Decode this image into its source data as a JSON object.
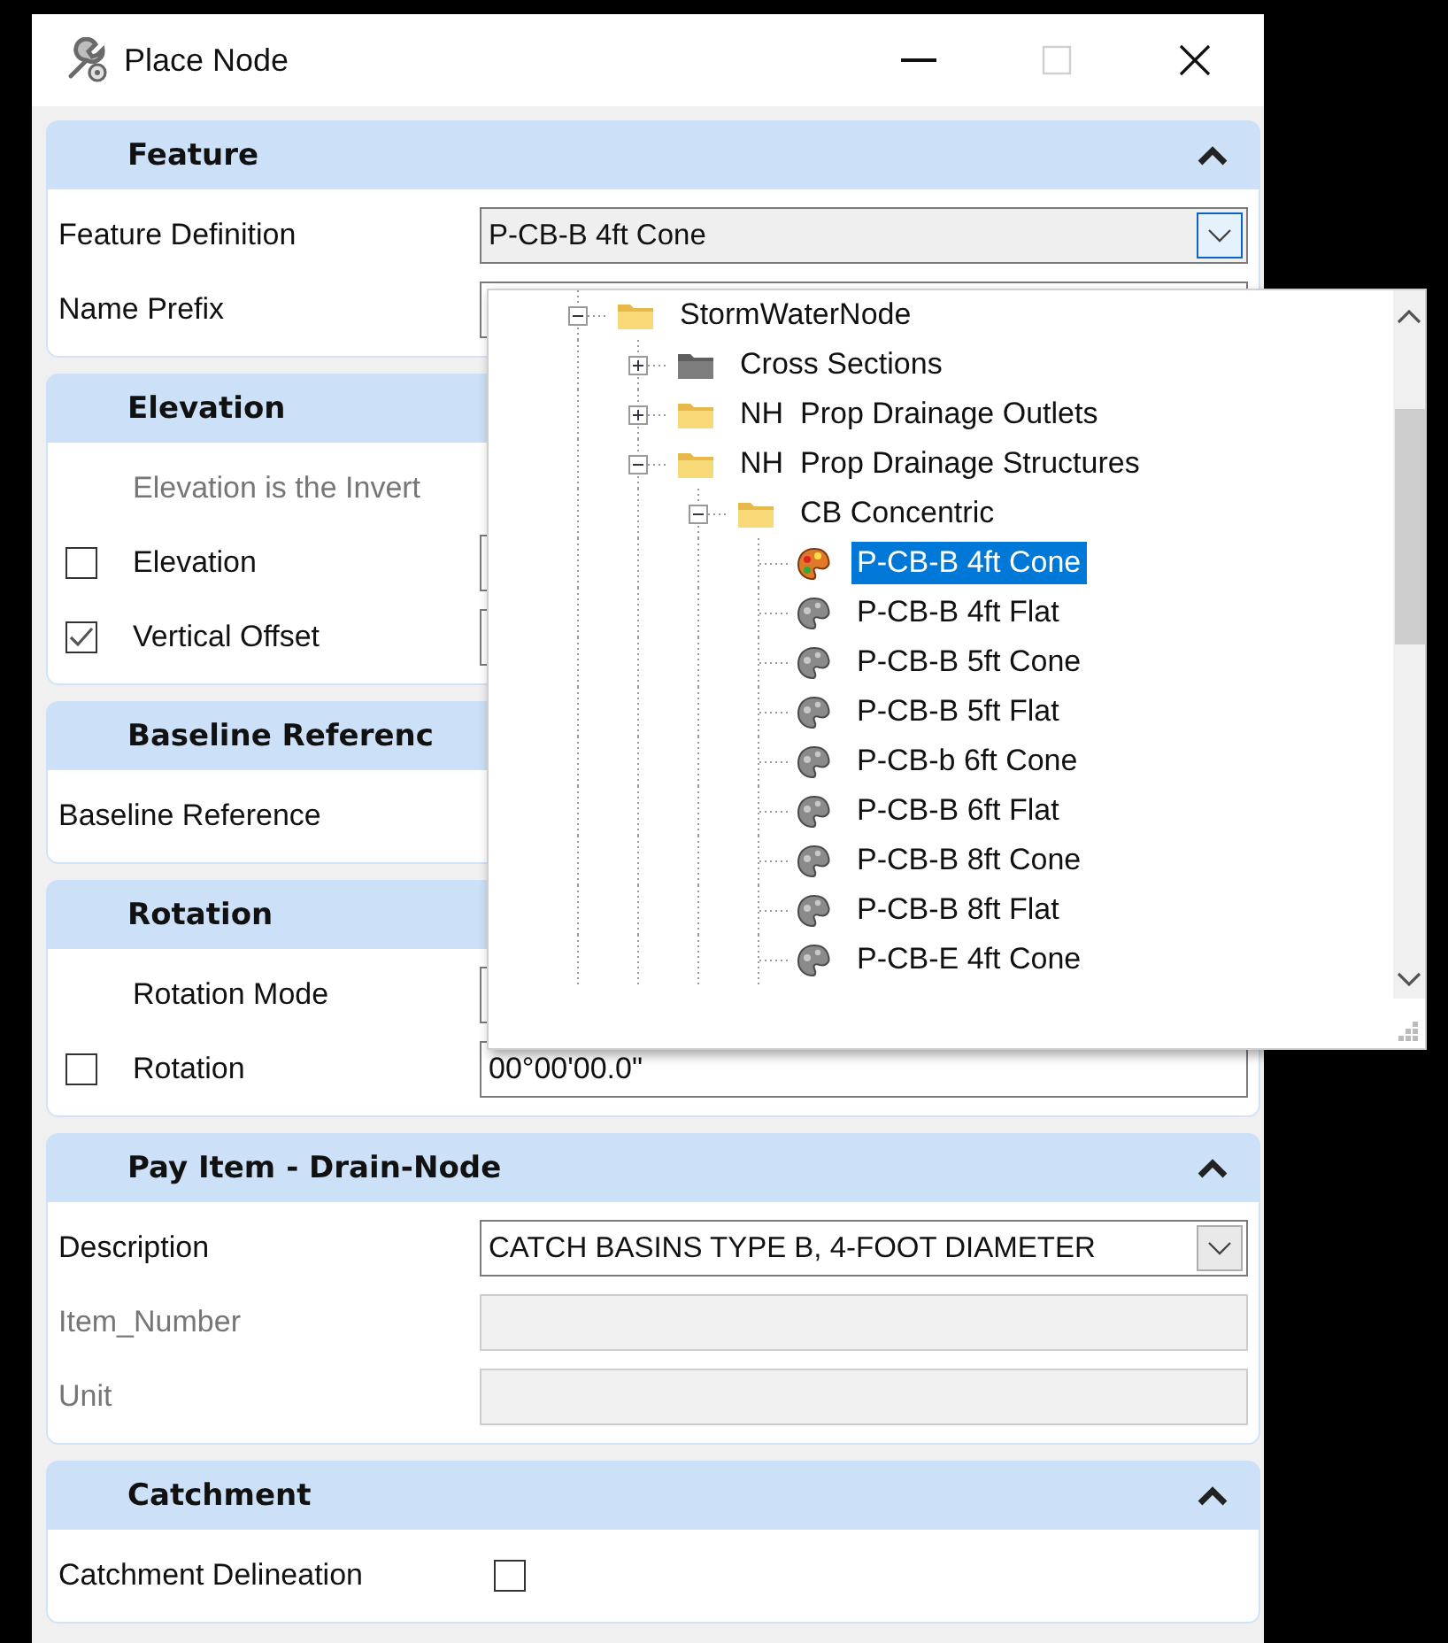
{
  "window": {
    "title": "Place Node"
  },
  "title_buttons": [
    {
      "kind": "minimize",
      "disabled": false
    },
    {
      "kind": "maximize",
      "disabled": true
    },
    {
      "kind": "close",
      "disabled": false
    }
  ],
  "sections": [
    {
      "title": "Feature",
      "expanded": true,
      "rows": [
        {
          "kind": "combo",
          "label": "Feature Definition",
          "value": "P-CB-B 4ft Cone",
          "focused": true
        },
        {
          "kind": "field",
          "label": "Name Prefix",
          "disabled": false
        }
      ]
    },
    {
      "title": "Elevation",
      "rows": [
        {
          "kind": "note",
          "text": "Elevation is the Invert"
        },
        {
          "kind": "check",
          "label": "Elevation",
          "checked": false
        },
        {
          "kind": "check",
          "label": "Vertical Offset",
          "checked": true
        }
      ]
    },
    {
      "title": "Baseline Referenc",
      "rows": [
        {
          "kind": "label",
          "label": "Baseline Reference"
        }
      ]
    },
    {
      "title": "Rotation",
      "rows": [
        {
          "kind": "indented-field",
          "label": "Rotation Mode"
        },
        {
          "kind": "check",
          "label": "Rotation",
          "checked": false,
          "value": "00°00'00.0\""
        }
      ]
    },
    {
      "title": "Pay Item - Drain-Node",
      "expanded": true,
      "rows": [
        {
          "kind": "combo",
          "label": "Description",
          "value": "CATCH BASINS TYPE B, 4-FOOT DIAMETER",
          "focused": false
        },
        {
          "kind": "field",
          "label": "Item_Number",
          "disabled": true
        },
        {
          "kind": "field",
          "label": "Unit",
          "disabled": true
        }
      ]
    },
    {
      "title": "Catchment",
      "expanded": true,
      "rows": [
        {
          "kind": "toggle",
          "label": "Catchment Delineation",
          "checked": false
        }
      ]
    }
  ],
  "dropdown": {
    "tree": [
      {
        "kind": "folder",
        "label": "StormWaterNode",
        "expanded": true,
        "selected": false,
        "children": [
          {
            "kind": "gray-folder",
            "label": "Cross Sections",
            "expanded": false,
            "selected": false
          },
          {
            "kind": "folder",
            "label": "NH  Prop Drainage Outlets",
            "expanded": false,
            "selected": false
          },
          {
            "kind": "folder",
            "label": "NH  Prop Drainage Structures",
            "expanded": true,
            "selected": false,
            "children": [
              {
                "kind": "folder",
                "label": "CB Concentric",
                "expanded": true,
                "selected": false,
                "children": [
                  {
                    "kind": "feature",
                    "label": "P-CB-B 4ft Cone",
                    "selected": true
                  },
                  {
                    "kind": "feature",
                    "label": "P-CB-B 4ft Flat",
                    "selected": false
                  },
                  {
                    "kind": "feature",
                    "label": "P-CB-B 5ft Cone",
                    "selected": false
                  },
                  {
                    "kind": "feature",
                    "label": "P-CB-B 5ft Flat",
                    "selected": false
                  },
                  {
                    "kind": "feature",
                    "label": "P-CB-b 6ft Cone",
                    "selected": false
                  },
                  {
                    "kind": "feature",
                    "label": "P-CB-B 6ft Flat",
                    "selected": false
                  },
                  {
                    "kind": "feature",
                    "label": "P-CB-B 8ft Cone",
                    "selected": false
                  },
                  {
                    "kind": "feature",
                    "label": "P-CB-B 8ft Flat",
                    "selected": false
                  },
                  {
                    "kind": "feature",
                    "label": "P-CB-E 4ft Cone",
                    "selected": false
                  }
                ]
              }
            ]
          }
        ]
      }
    ]
  }
}
